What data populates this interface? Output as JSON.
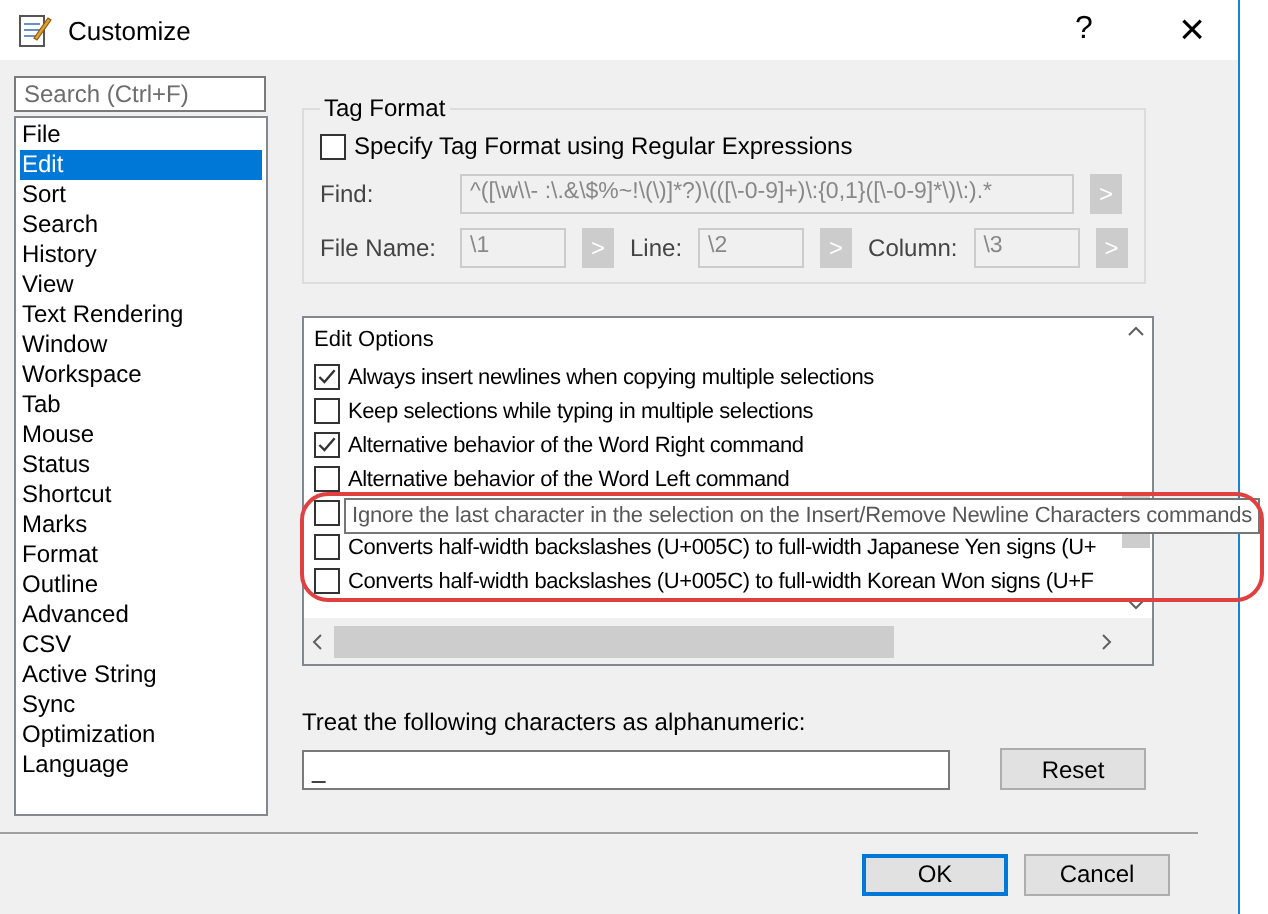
{
  "window": {
    "title": "Customize",
    "help": "?",
    "close": "×"
  },
  "sidebar": {
    "search": {
      "placeholder": "Search (Ctrl+F)"
    },
    "items": [
      {
        "label": "File",
        "selected": false
      },
      {
        "label": "Edit",
        "selected": true
      },
      {
        "label": "Sort",
        "selected": false
      },
      {
        "label": "Search",
        "selected": false
      },
      {
        "label": "History",
        "selected": false
      },
      {
        "label": "View",
        "selected": false
      },
      {
        "label": "Text Rendering",
        "selected": false
      },
      {
        "label": "Window",
        "selected": false
      },
      {
        "label": "Workspace",
        "selected": false
      },
      {
        "label": "Tab",
        "selected": false
      },
      {
        "label": "Mouse",
        "selected": false
      },
      {
        "label": "Status",
        "selected": false
      },
      {
        "label": "Shortcut",
        "selected": false
      },
      {
        "label": "Marks",
        "selected": false
      },
      {
        "label": "Format",
        "selected": false
      },
      {
        "label": "Outline",
        "selected": false
      },
      {
        "label": "Advanced",
        "selected": false
      },
      {
        "label": "CSV",
        "selected": false
      },
      {
        "label": "Active String",
        "selected": false
      },
      {
        "label": "Sync",
        "selected": false
      },
      {
        "label": "Optimization",
        "selected": false
      },
      {
        "label": "Language",
        "selected": false
      }
    ]
  },
  "tag_format": {
    "title": "Tag Format",
    "disabled": true,
    "regex": {
      "label": "Specify Tag Format using Regular Expressions",
      "checked": false
    },
    "find": {
      "label": "Find:",
      "value": "^([\\w\\\\- :\\.&\\$%~!\\(\\)]*?)\\(([\\-0-9]+)\\:{0,1}([\\-0-9]*\\)\\:).*",
      "button": ">"
    },
    "fields": [
      {
        "label": "File Name:",
        "value": "\\1",
        "button": ">"
      },
      {
        "label": "Line:",
        "value": "\\2",
        "button": ">"
      },
      {
        "label": "Column:",
        "value": "\\3",
        "button": ">"
      }
    ]
  },
  "edit_options": {
    "title": "Edit Options",
    "items": [
      {
        "label": "Always insert newlines when copying multiple selections",
        "checked": true
      },
      {
        "label": "Keep selections while typing in multiple selections",
        "checked": false
      },
      {
        "label": "Alternative behavior of the Word Right command",
        "checked": true
      },
      {
        "label": "Alternative behavior of the Word Left command",
        "checked": false
      },
      {
        "checked": false,
        "tooltip": "Ignore the last character in the selection on the Insert/Remove Newline Characters commands"
      },
      {
        "label": "Converts half-width backslashes (U+005C) to full-width Japanese Yen signs (U+",
        "checked": false
      },
      {
        "label": "Converts half-width backslashes (U+005C) to full-width Korean Won signs (U+F",
        "checked": false
      }
    ]
  },
  "alphanumeric": {
    "label": "Treat the following characters as alphanumeric:",
    "value": "_",
    "button": "Reset"
  },
  "buttons": [
    {
      "label": "OK",
      "default": true
    },
    {
      "label": "Cancel",
      "default": false
    }
  ],
  "annotation": {
    "shown": true
  }
}
